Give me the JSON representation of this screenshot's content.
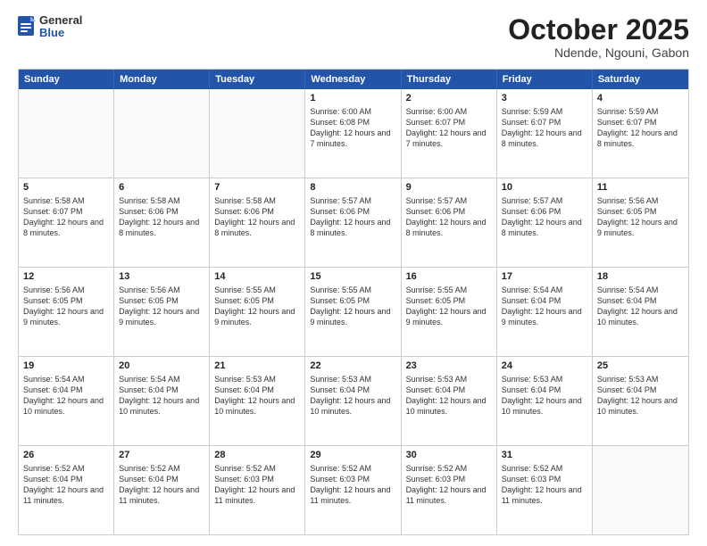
{
  "header": {
    "logo_general": "General",
    "logo_blue": "Blue",
    "month_title": "October 2025",
    "location": "Ndende, Ngouni, Gabon"
  },
  "weekdays": [
    "Sunday",
    "Monday",
    "Tuesday",
    "Wednesday",
    "Thursday",
    "Friday",
    "Saturday"
  ],
  "rows": [
    [
      {
        "day": "",
        "info": ""
      },
      {
        "day": "",
        "info": ""
      },
      {
        "day": "",
        "info": ""
      },
      {
        "day": "1",
        "info": "Sunrise: 6:00 AM\nSunset: 6:08 PM\nDaylight: 12 hours and 7 minutes."
      },
      {
        "day": "2",
        "info": "Sunrise: 6:00 AM\nSunset: 6:07 PM\nDaylight: 12 hours and 7 minutes."
      },
      {
        "day": "3",
        "info": "Sunrise: 5:59 AM\nSunset: 6:07 PM\nDaylight: 12 hours and 8 minutes."
      },
      {
        "day": "4",
        "info": "Sunrise: 5:59 AM\nSunset: 6:07 PM\nDaylight: 12 hours and 8 minutes."
      }
    ],
    [
      {
        "day": "5",
        "info": "Sunrise: 5:58 AM\nSunset: 6:07 PM\nDaylight: 12 hours and 8 minutes."
      },
      {
        "day": "6",
        "info": "Sunrise: 5:58 AM\nSunset: 6:06 PM\nDaylight: 12 hours and 8 minutes."
      },
      {
        "day": "7",
        "info": "Sunrise: 5:58 AM\nSunset: 6:06 PM\nDaylight: 12 hours and 8 minutes."
      },
      {
        "day": "8",
        "info": "Sunrise: 5:57 AM\nSunset: 6:06 PM\nDaylight: 12 hours and 8 minutes."
      },
      {
        "day": "9",
        "info": "Sunrise: 5:57 AM\nSunset: 6:06 PM\nDaylight: 12 hours and 8 minutes."
      },
      {
        "day": "10",
        "info": "Sunrise: 5:57 AM\nSunset: 6:06 PM\nDaylight: 12 hours and 8 minutes."
      },
      {
        "day": "11",
        "info": "Sunrise: 5:56 AM\nSunset: 6:05 PM\nDaylight: 12 hours and 9 minutes."
      }
    ],
    [
      {
        "day": "12",
        "info": "Sunrise: 5:56 AM\nSunset: 6:05 PM\nDaylight: 12 hours and 9 minutes."
      },
      {
        "day": "13",
        "info": "Sunrise: 5:56 AM\nSunset: 6:05 PM\nDaylight: 12 hours and 9 minutes."
      },
      {
        "day": "14",
        "info": "Sunrise: 5:55 AM\nSunset: 6:05 PM\nDaylight: 12 hours and 9 minutes."
      },
      {
        "day": "15",
        "info": "Sunrise: 5:55 AM\nSunset: 6:05 PM\nDaylight: 12 hours and 9 minutes."
      },
      {
        "day": "16",
        "info": "Sunrise: 5:55 AM\nSunset: 6:05 PM\nDaylight: 12 hours and 9 minutes."
      },
      {
        "day": "17",
        "info": "Sunrise: 5:54 AM\nSunset: 6:04 PM\nDaylight: 12 hours and 9 minutes."
      },
      {
        "day": "18",
        "info": "Sunrise: 5:54 AM\nSunset: 6:04 PM\nDaylight: 12 hours and 10 minutes."
      }
    ],
    [
      {
        "day": "19",
        "info": "Sunrise: 5:54 AM\nSunset: 6:04 PM\nDaylight: 12 hours and 10 minutes."
      },
      {
        "day": "20",
        "info": "Sunrise: 5:54 AM\nSunset: 6:04 PM\nDaylight: 12 hours and 10 minutes."
      },
      {
        "day": "21",
        "info": "Sunrise: 5:53 AM\nSunset: 6:04 PM\nDaylight: 12 hours and 10 minutes."
      },
      {
        "day": "22",
        "info": "Sunrise: 5:53 AM\nSunset: 6:04 PM\nDaylight: 12 hours and 10 minutes."
      },
      {
        "day": "23",
        "info": "Sunrise: 5:53 AM\nSunset: 6:04 PM\nDaylight: 12 hours and 10 minutes."
      },
      {
        "day": "24",
        "info": "Sunrise: 5:53 AM\nSunset: 6:04 PM\nDaylight: 12 hours and 10 minutes."
      },
      {
        "day": "25",
        "info": "Sunrise: 5:53 AM\nSunset: 6:04 PM\nDaylight: 12 hours and 10 minutes."
      }
    ],
    [
      {
        "day": "26",
        "info": "Sunrise: 5:52 AM\nSunset: 6:04 PM\nDaylight: 12 hours and 11 minutes."
      },
      {
        "day": "27",
        "info": "Sunrise: 5:52 AM\nSunset: 6:04 PM\nDaylight: 12 hours and 11 minutes."
      },
      {
        "day": "28",
        "info": "Sunrise: 5:52 AM\nSunset: 6:03 PM\nDaylight: 12 hours and 11 minutes."
      },
      {
        "day": "29",
        "info": "Sunrise: 5:52 AM\nSunset: 6:03 PM\nDaylight: 12 hours and 11 minutes."
      },
      {
        "day": "30",
        "info": "Sunrise: 5:52 AM\nSunset: 6:03 PM\nDaylight: 12 hours and 11 minutes."
      },
      {
        "day": "31",
        "info": "Sunrise: 5:52 AM\nSunset: 6:03 PM\nDaylight: 12 hours and 11 minutes."
      },
      {
        "day": "",
        "info": ""
      }
    ]
  ]
}
